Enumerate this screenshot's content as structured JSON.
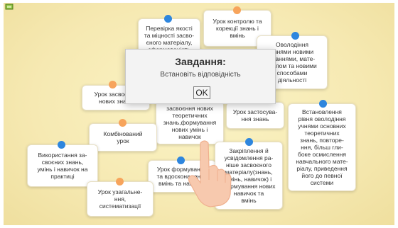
{
  "dialog": {
    "title": "Завдання:",
    "message": "Встановіть відповідність",
    "ok_label": "OK"
  },
  "cards": [
    {
      "text": "Перевірка якості\nта міцності засво-\nєного матеріалу,\nсформованість"
    },
    {
      "text": "Урок контролю та\nкорекції знань і\nвмінь"
    },
    {
      "text": "Оволодіння\nучнями новими\nзнаннями, мате-\nріалом та новими\nспособами\nдіяльності"
    },
    {
      "text": "Урок засвоєння\nнових знань"
    },
    {
      "text": "засвоєння нових\nтеоретичних\nзнань,формування\nнових умінь і\nнавичок"
    },
    {
      "text": "Урок застосува-\nння знань"
    },
    {
      "text": "Встановлення\nрівня оволодіння\nучнями основних\nтеоретичних\nзнань, повторе-\nння, більш гли-\nбоке осмислення\nнавчального мате-\nріалу, приведення\nйого до певної\nсистеми"
    },
    {
      "text": "Комбінований\nурок"
    },
    {
      "text": "Використання за-\nсвоєних знань,\nумінь і навичок на\nпрактиці"
    },
    {
      "text": "Урок формування\nта вдосконалення\nвмінь та навичок"
    },
    {
      "text": "Закріплення й\nусвідомлення ра-\nніше засвоєного\nматеріалу(знань,\nумінь, навичок) і\nформування нових\nнавичок та\nвмінь"
    },
    {
      "text": "Урок узагальне-\nння,\nсистематизації"
    }
  ],
  "colors": {
    "dot_blue": "#2e86de",
    "dot_orange": "#f7a45c",
    "background": "#f6e9b2"
  },
  "icons": [
    "app-corner-icon",
    "hand-pointer-icon"
  ]
}
